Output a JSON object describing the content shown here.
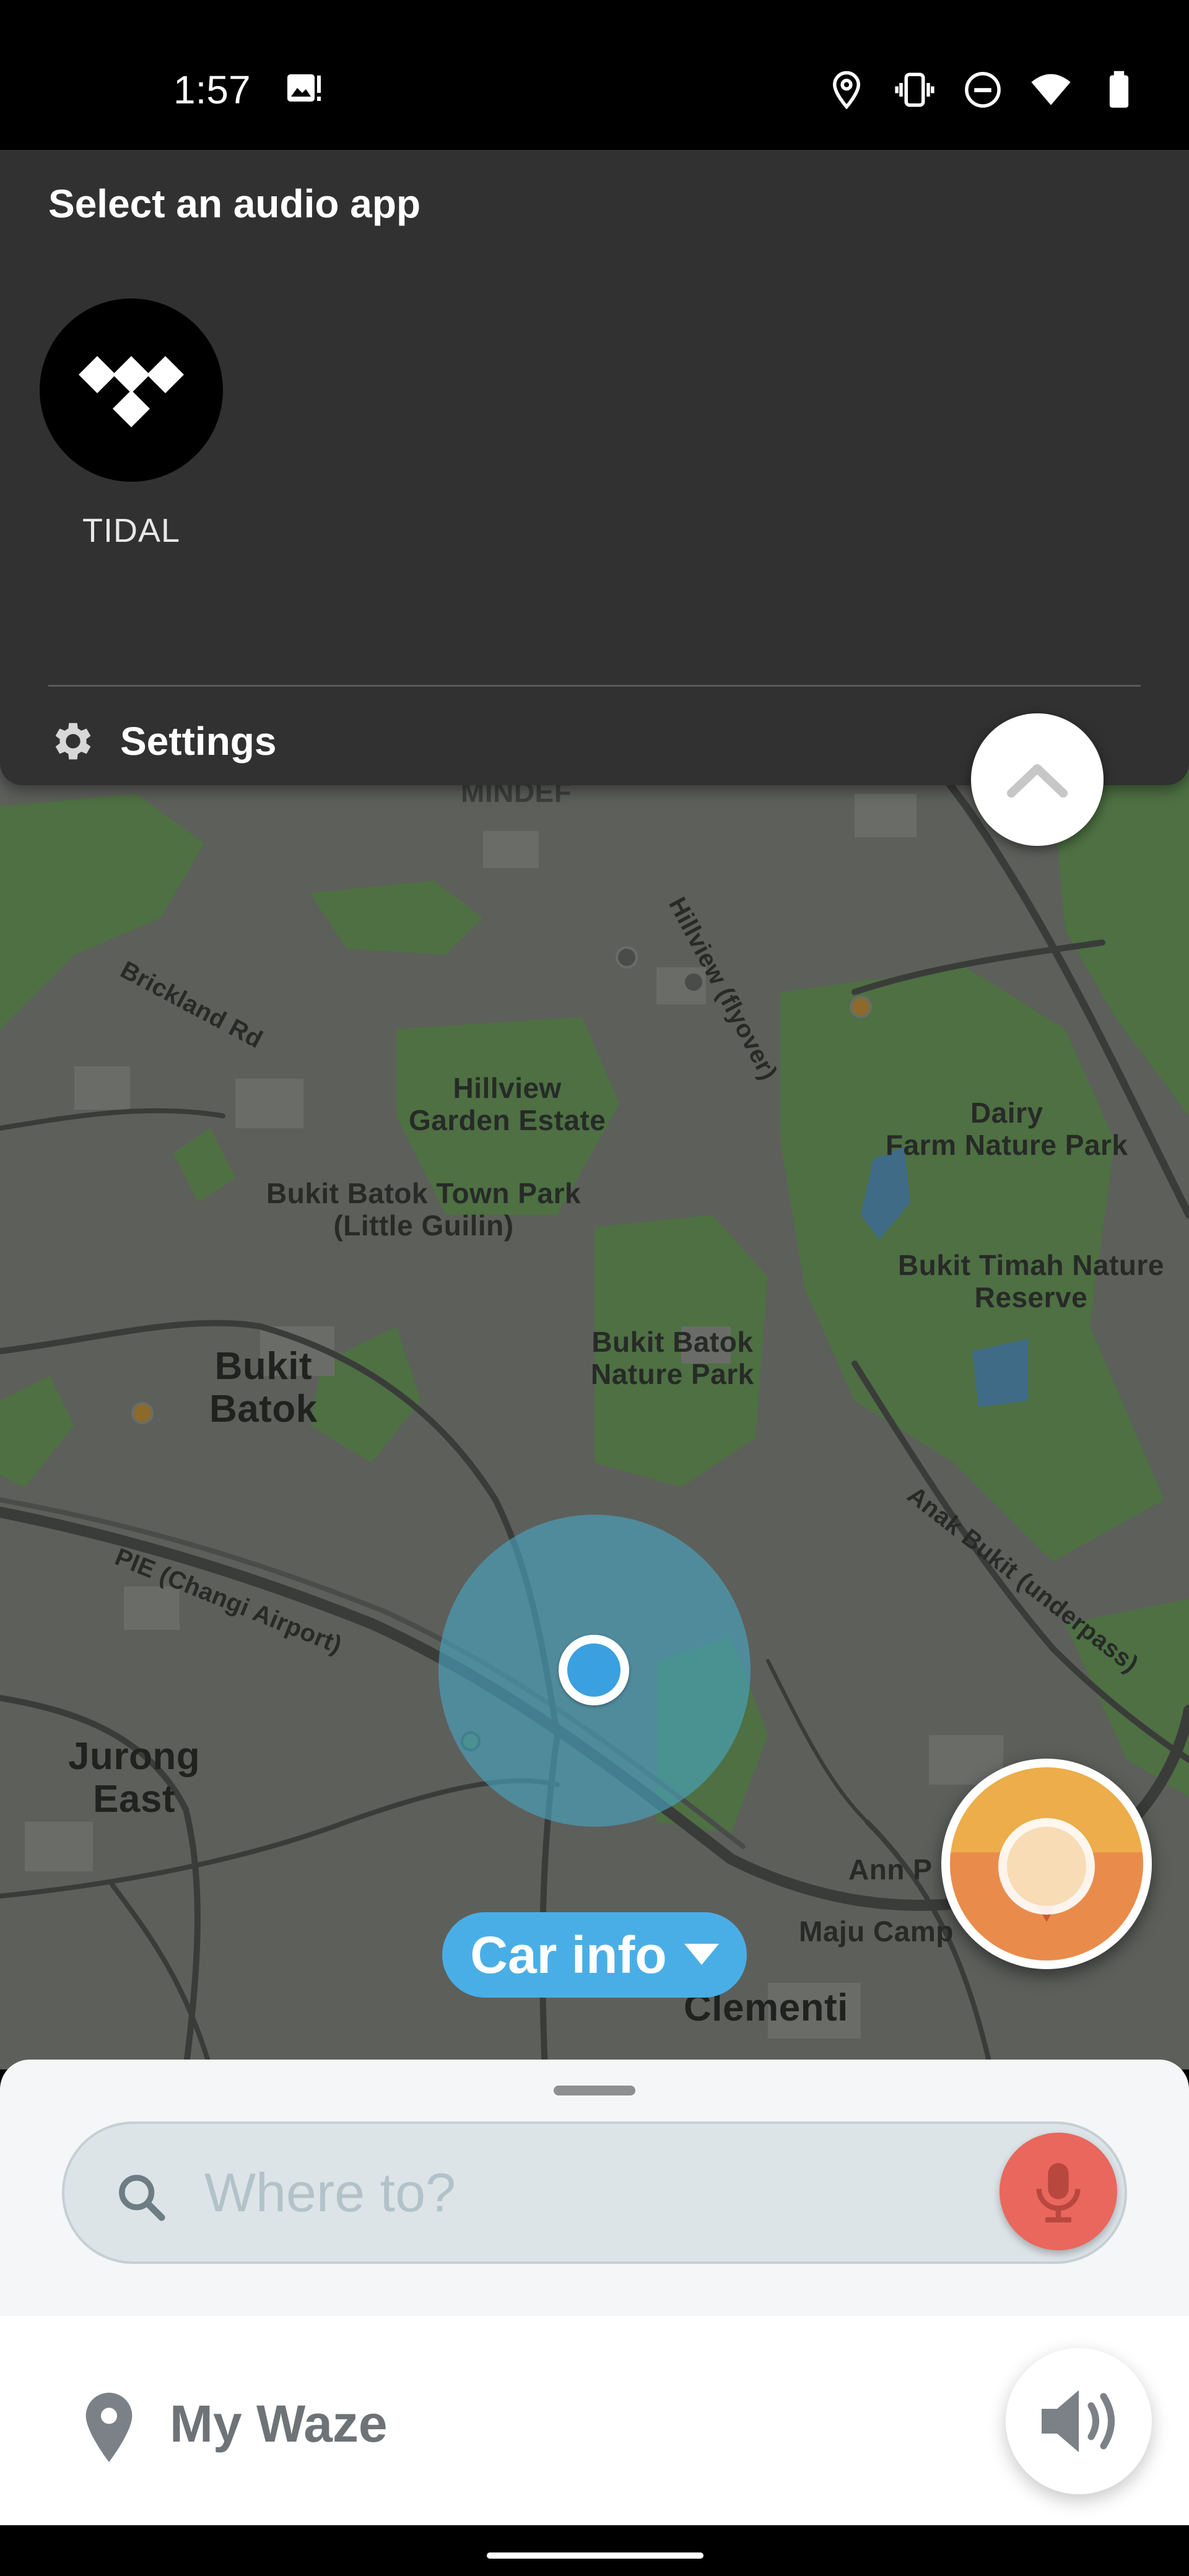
{
  "status_bar": {
    "time": "1:57",
    "icons": [
      "image-icon",
      "location-icon",
      "vibrate-icon",
      "do-not-disturb-icon",
      "wifi-icon",
      "battery-icon"
    ]
  },
  "audio_panel": {
    "title": "Select an audio app",
    "apps": [
      {
        "label": "TIDAL",
        "icon": "tidal-logo-icon"
      }
    ],
    "settings_label": "Settings"
  },
  "map": {
    "labels": {
      "mindef": "MINDEF",
      "brickland": "Brickland Rd",
      "hillview_flyover": "Hillview (flyover)",
      "hillview_garden": "Hillview\nGarden Estate",
      "dairy_farm": "Dairy\nFarm Nature Park",
      "bukit_batok_town_park": "Bukit Batok Town Park\n(Little Guilin)",
      "bukit_timah": "Bukit Timah Nature\nReserve",
      "bukit_batok": "Bukit\nBatok",
      "bukit_batok_nature": "Bukit Batok\nNature Park",
      "anak_bukit": "Anak Bukit (underpass)",
      "pie": "PIE (Changi Airport)",
      "jurong_east": "Jurong\nEast",
      "ann_pee": "Ann P",
      "maju_camp": "Maju Camp",
      "clementi": "Clementi"
    },
    "colors": {
      "land": "#5d5f5b",
      "park": "#4e7043",
      "road": "#3a3c3a",
      "water": "#3f6b86"
    }
  },
  "car_info": {
    "label": "Car info"
  },
  "search": {
    "placeholder": "Where to?",
    "value": ""
  },
  "my_waze": {
    "label": "My Waze"
  },
  "colors": {
    "accent_blue": "#4aaee6",
    "mic_red": "#e9675d",
    "report_orange": "#e98c4b",
    "panel_bg": "#313131"
  }
}
